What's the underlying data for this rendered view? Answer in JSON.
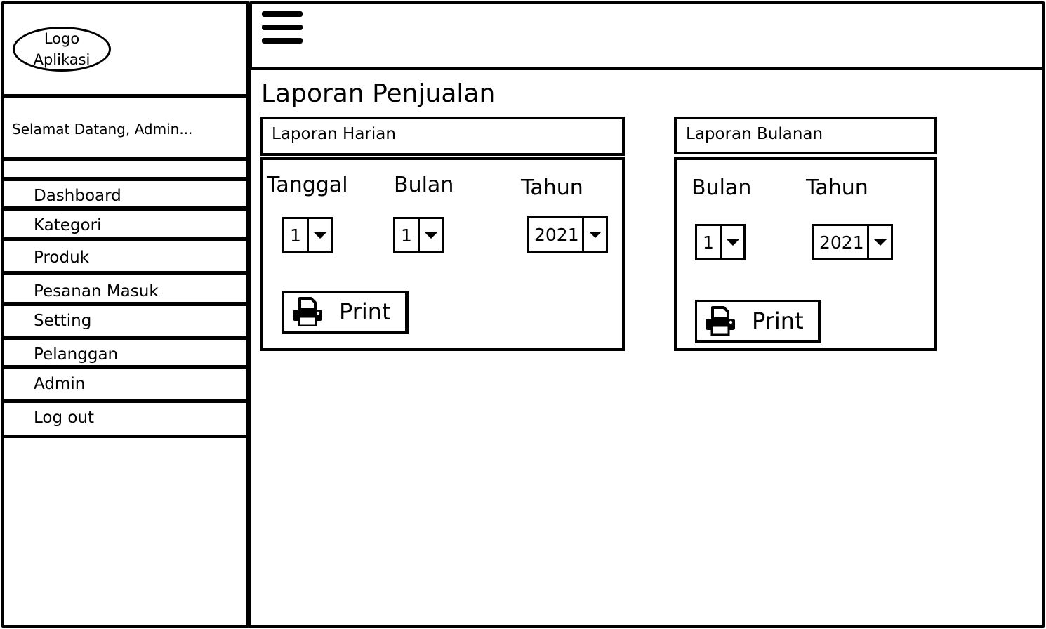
{
  "app": {
    "logo_line1": "Logo",
    "logo_line2": "Aplikasi",
    "welcome": "Selamat Datang, Admin..."
  },
  "sidebar": {
    "items": [
      {
        "label": "Dashboard"
      },
      {
        "label": "Kategori"
      },
      {
        "label": "Produk"
      },
      {
        "label": "Pesanan Masuk"
      },
      {
        "label": "Setting"
      },
      {
        "label": "Pelanggan"
      },
      {
        "label": "Admin"
      },
      {
        "label": "Log out"
      }
    ]
  },
  "header": {
    "menu_icon": "hamburger-menu-icon"
  },
  "main": {
    "title": "Laporan Penjualan",
    "daily": {
      "title": "Laporan Harian",
      "date_label": "Tanggal",
      "date_value": "1",
      "month_label": "Bulan",
      "month_value": "1",
      "year_label": "Tahun",
      "year_value": "2021",
      "print_label": "Print"
    },
    "monthly": {
      "title": "Laporan Bulanan",
      "month_label": "Bulan",
      "month_value": "1",
      "year_label": "Tahun",
      "year_value": "2021",
      "print_label": "Print"
    }
  },
  "colors": {
    "stroke": "#000000",
    "background": "#ffffff"
  }
}
